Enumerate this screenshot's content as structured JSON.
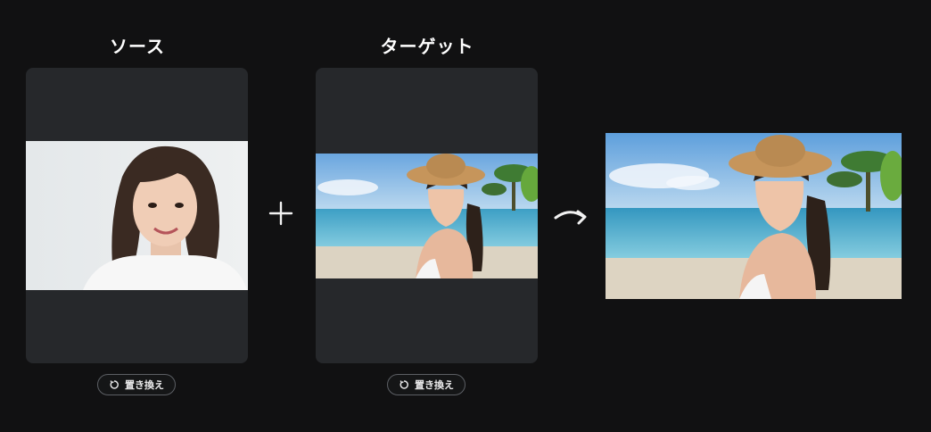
{
  "source": {
    "title": "ソース",
    "replace_label": "置き換え"
  },
  "target": {
    "title": "ターゲット",
    "replace_label": "置き換え"
  },
  "icons": {
    "plus": "plus-icon",
    "arrow": "curved-arrow-right-icon",
    "replace": "refresh-icon"
  },
  "colors": {
    "background": "#111112",
    "panel": "#26282b",
    "button_border": "#5c5f64"
  }
}
